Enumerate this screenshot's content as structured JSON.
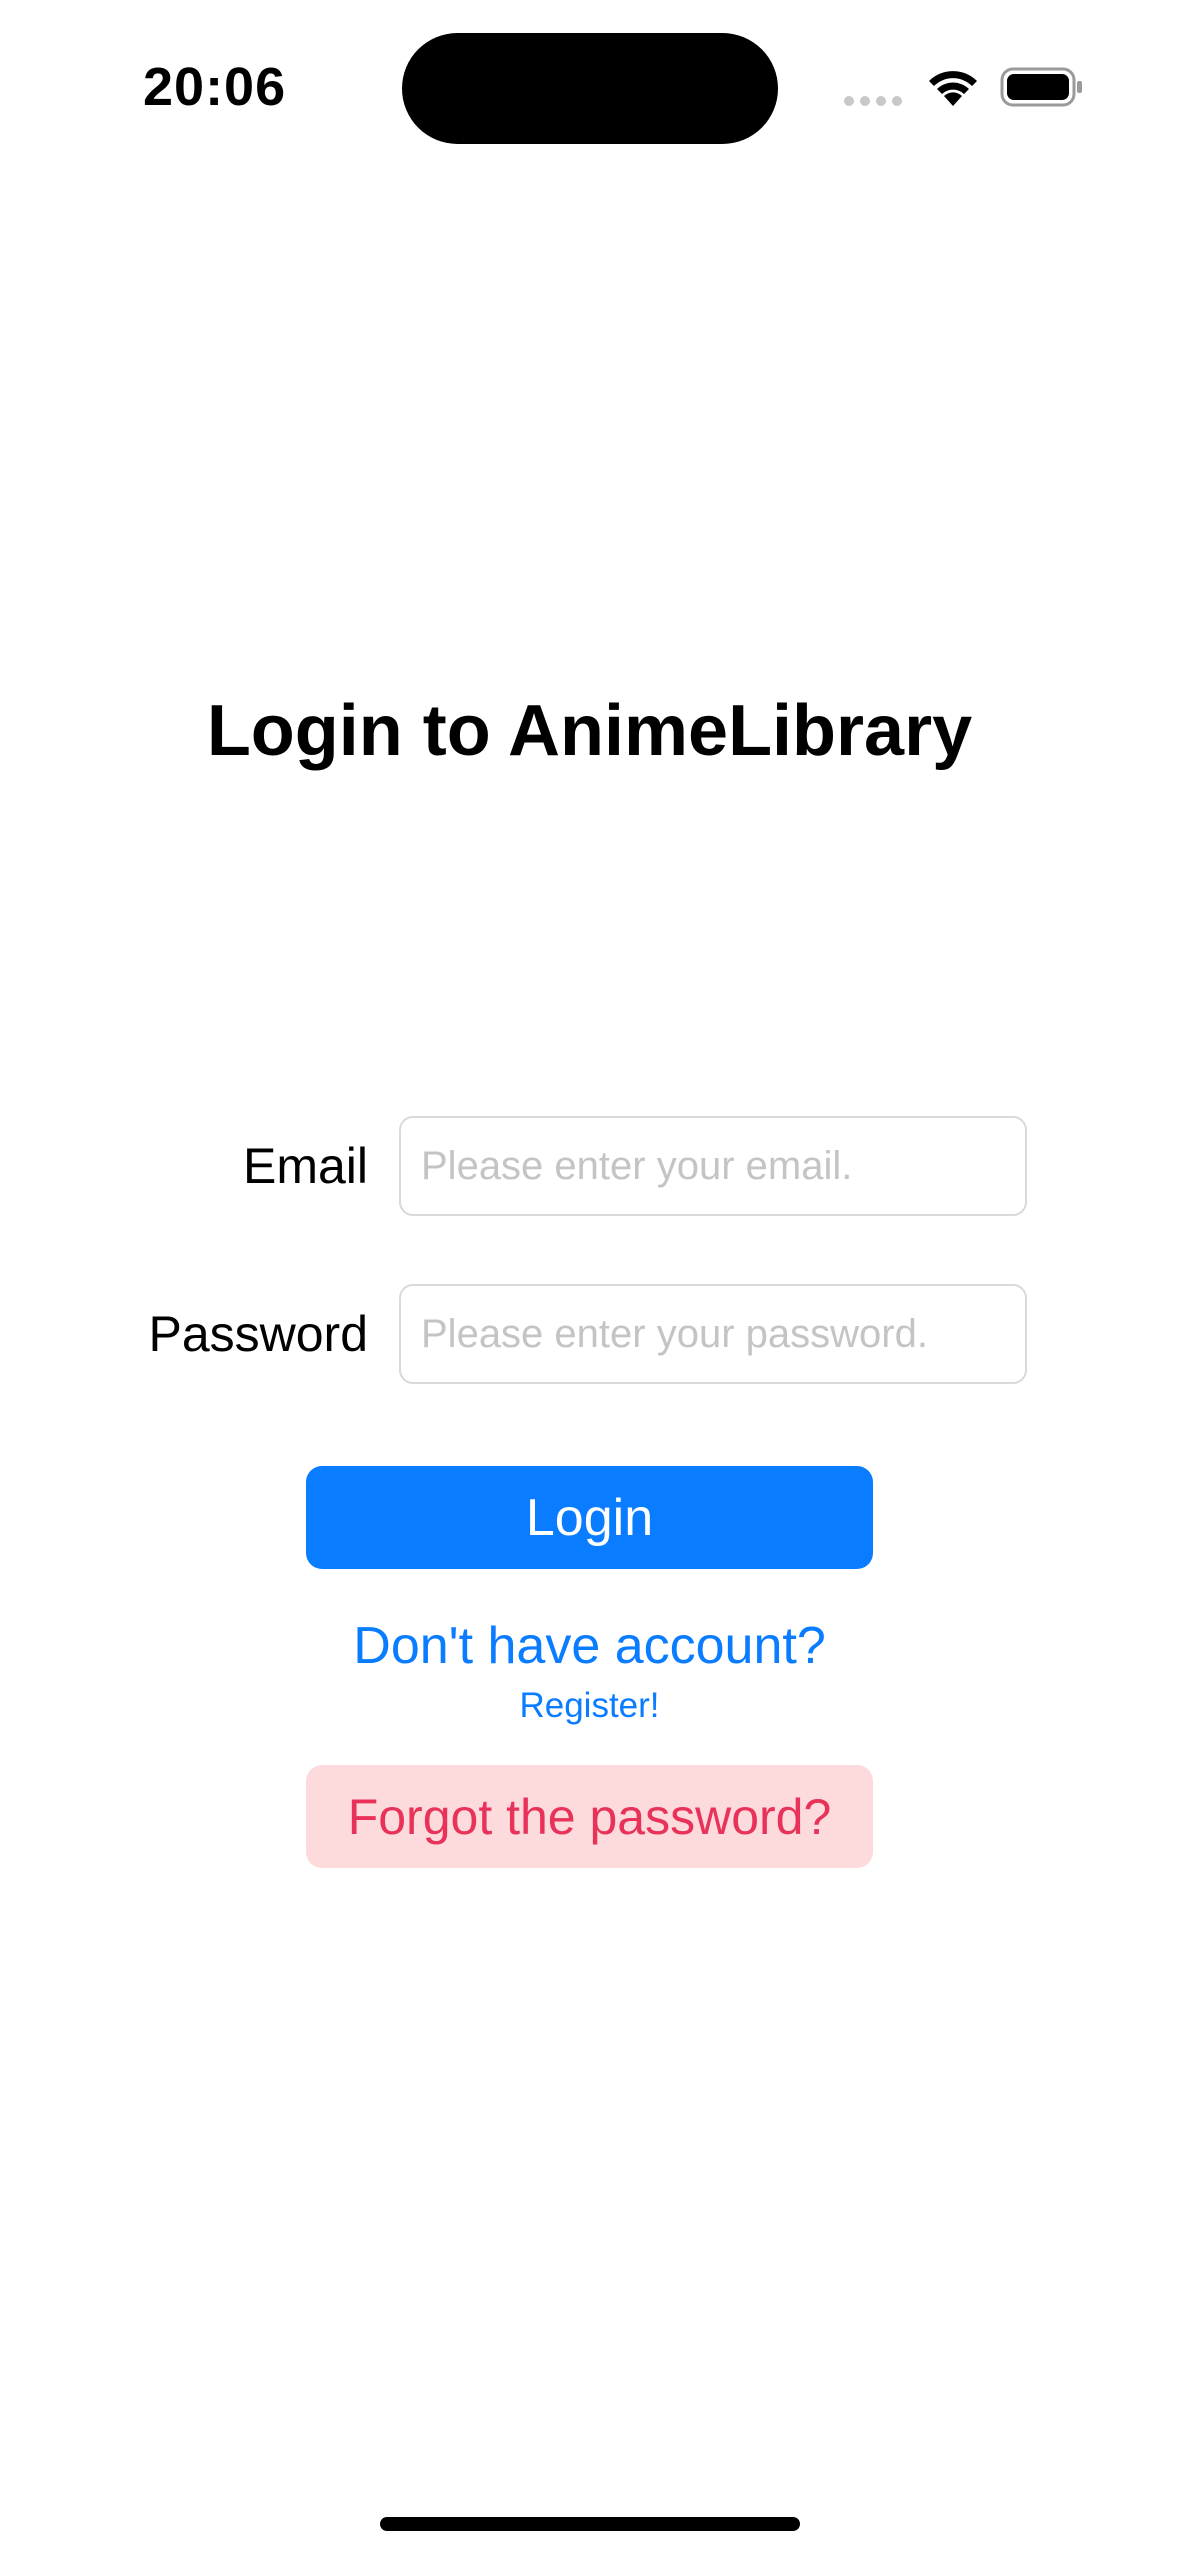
{
  "status_bar": {
    "time": "20:06"
  },
  "page": {
    "title": "Login to AnimeLibrary"
  },
  "form": {
    "email_label": "Email",
    "email_value": "",
    "email_placeholder": "Please enter your email.",
    "password_label": "Password",
    "password_value": "",
    "password_placeholder": "Please enter your password."
  },
  "actions": {
    "login_label": "Login",
    "register_prompt": "Don't have account?",
    "register_label": "Register!",
    "forgot_label": "Forgot the password?"
  },
  "colors": {
    "accent": "#0a7cff",
    "danger_text": "#e8325a",
    "danger_background": "#fddbdc"
  },
  "icons": {
    "signal": "cellular-signal-icon",
    "wifi": "wifi-icon",
    "battery": "battery-icon"
  }
}
